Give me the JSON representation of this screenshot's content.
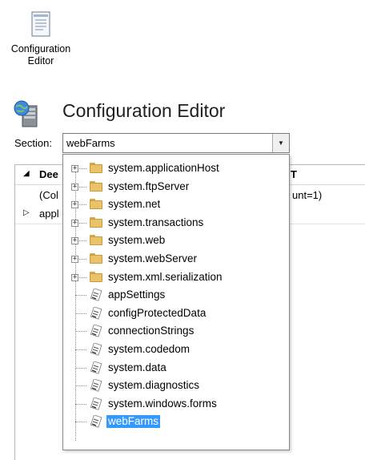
{
  "desktop_icon": {
    "label": "Configuration Editor",
    "icon": "configuration-editor-icon"
  },
  "header": {
    "title": "Configuration Editor",
    "icon": "server-globe-icon"
  },
  "section": {
    "label": "Section:",
    "value": "webFarms"
  },
  "grid_background": {
    "col1": "Dee",
    "col2": "T",
    "row1_col1": "(Col",
    "row1_col2": "unt=1)",
    "row2_col1": "appl"
  },
  "dropdown": {
    "items": [
      {
        "label": "system.applicationHost",
        "type": "folder",
        "expandable": true
      },
      {
        "label": "system.ftpServer",
        "type": "folder",
        "expandable": true
      },
      {
        "label": "system.net",
        "type": "folder",
        "expandable": true
      },
      {
        "label": "system.transactions",
        "type": "folder",
        "expandable": true
      },
      {
        "label": "system.web",
        "type": "folder",
        "expandable": true
      },
      {
        "label": "system.webServer",
        "type": "folder",
        "expandable": true
      },
      {
        "label": "system.xml.serialization",
        "type": "folder",
        "expandable": true
      },
      {
        "label": "appSettings",
        "type": "section",
        "expandable": false
      },
      {
        "label": "configProtectedData",
        "type": "section",
        "expandable": false
      },
      {
        "label": "connectionStrings",
        "type": "section",
        "expandable": false
      },
      {
        "label": "system.codedom",
        "type": "section",
        "expandable": false
      },
      {
        "label": "system.data",
        "type": "section",
        "expandable": false
      },
      {
        "label": "system.diagnostics",
        "type": "section",
        "expandable": false
      },
      {
        "label": "system.windows.forms",
        "type": "section",
        "expandable": false
      },
      {
        "label": "webFarms",
        "type": "section",
        "expandable": false,
        "selected": true
      }
    ]
  },
  "colors": {
    "selection": "#3399ff",
    "folder": "#e8c36a"
  }
}
